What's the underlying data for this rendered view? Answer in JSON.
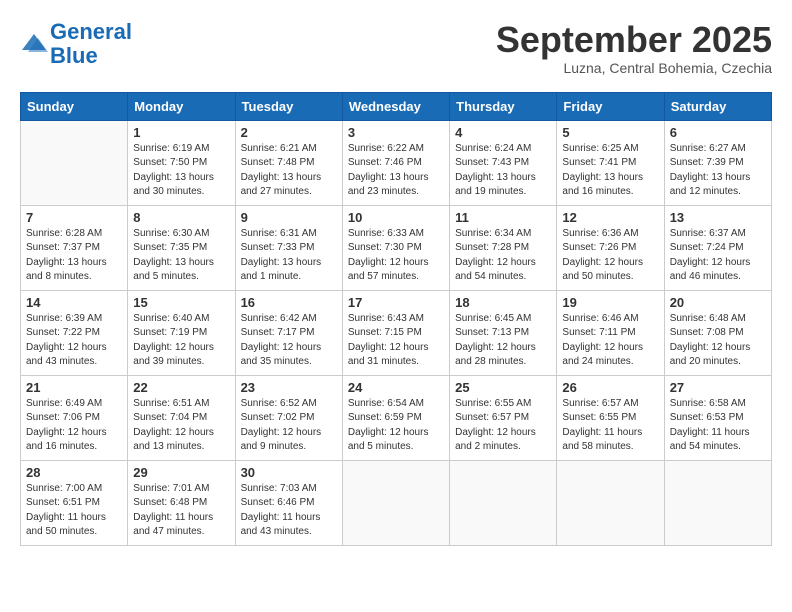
{
  "header": {
    "logo_line1": "General",
    "logo_line2": "Blue",
    "month": "September 2025",
    "location": "Luzna, Central Bohemia, Czechia"
  },
  "weekdays": [
    "Sunday",
    "Monday",
    "Tuesday",
    "Wednesday",
    "Thursday",
    "Friday",
    "Saturday"
  ],
  "weeks": [
    [
      {
        "day": "",
        "info": ""
      },
      {
        "day": "1",
        "info": "Sunrise: 6:19 AM\nSunset: 7:50 PM\nDaylight: 13 hours\nand 30 minutes."
      },
      {
        "day": "2",
        "info": "Sunrise: 6:21 AM\nSunset: 7:48 PM\nDaylight: 13 hours\nand 27 minutes."
      },
      {
        "day": "3",
        "info": "Sunrise: 6:22 AM\nSunset: 7:46 PM\nDaylight: 13 hours\nand 23 minutes."
      },
      {
        "day": "4",
        "info": "Sunrise: 6:24 AM\nSunset: 7:43 PM\nDaylight: 13 hours\nand 19 minutes."
      },
      {
        "day": "5",
        "info": "Sunrise: 6:25 AM\nSunset: 7:41 PM\nDaylight: 13 hours\nand 16 minutes."
      },
      {
        "day": "6",
        "info": "Sunrise: 6:27 AM\nSunset: 7:39 PM\nDaylight: 13 hours\nand 12 minutes."
      }
    ],
    [
      {
        "day": "7",
        "info": "Sunrise: 6:28 AM\nSunset: 7:37 PM\nDaylight: 13 hours\nand 8 minutes."
      },
      {
        "day": "8",
        "info": "Sunrise: 6:30 AM\nSunset: 7:35 PM\nDaylight: 13 hours\nand 5 minutes."
      },
      {
        "day": "9",
        "info": "Sunrise: 6:31 AM\nSunset: 7:33 PM\nDaylight: 13 hours\nand 1 minute."
      },
      {
        "day": "10",
        "info": "Sunrise: 6:33 AM\nSunset: 7:30 PM\nDaylight: 12 hours\nand 57 minutes."
      },
      {
        "day": "11",
        "info": "Sunrise: 6:34 AM\nSunset: 7:28 PM\nDaylight: 12 hours\nand 54 minutes."
      },
      {
        "day": "12",
        "info": "Sunrise: 6:36 AM\nSunset: 7:26 PM\nDaylight: 12 hours\nand 50 minutes."
      },
      {
        "day": "13",
        "info": "Sunrise: 6:37 AM\nSunset: 7:24 PM\nDaylight: 12 hours\nand 46 minutes."
      }
    ],
    [
      {
        "day": "14",
        "info": "Sunrise: 6:39 AM\nSunset: 7:22 PM\nDaylight: 12 hours\nand 43 minutes."
      },
      {
        "day": "15",
        "info": "Sunrise: 6:40 AM\nSunset: 7:19 PM\nDaylight: 12 hours\nand 39 minutes."
      },
      {
        "day": "16",
        "info": "Sunrise: 6:42 AM\nSunset: 7:17 PM\nDaylight: 12 hours\nand 35 minutes."
      },
      {
        "day": "17",
        "info": "Sunrise: 6:43 AM\nSunset: 7:15 PM\nDaylight: 12 hours\nand 31 minutes."
      },
      {
        "day": "18",
        "info": "Sunrise: 6:45 AM\nSunset: 7:13 PM\nDaylight: 12 hours\nand 28 minutes."
      },
      {
        "day": "19",
        "info": "Sunrise: 6:46 AM\nSunset: 7:11 PM\nDaylight: 12 hours\nand 24 minutes."
      },
      {
        "day": "20",
        "info": "Sunrise: 6:48 AM\nSunset: 7:08 PM\nDaylight: 12 hours\nand 20 minutes."
      }
    ],
    [
      {
        "day": "21",
        "info": "Sunrise: 6:49 AM\nSunset: 7:06 PM\nDaylight: 12 hours\nand 16 minutes."
      },
      {
        "day": "22",
        "info": "Sunrise: 6:51 AM\nSunset: 7:04 PM\nDaylight: 12 hours\nand 13 minutes."
      },
      {
        "day": "23",
        "info": "Sunrise: 6:52 AM\nSunset: 7:02 PM\nDaylight: 12 hours\nand 9 minutes."
      },
      {
        "day": "24",
        "info": "Sunrise: 6:54 AM\nSunset: 6:59 PM\nDaylight: 12 hours\nand 5 minutes."
      },
      {
        "day": "25",
        "info": "Sunrise: 6:55 AM\nSunset: 6:57 PM\nDaylight: 12 hours\nand 2 minutes."
      },
      {
        "day": "26",
        "info": "Sunrise: 6:57 AM\nSunset: 6:55 PM\nDaylight: 11 hours\nand 58 minutes."
      },
      {
        "day": "27",
        "info": "Sunrise: 6:58 AM\nSunset: 6:53 PM\nDaylight: 11 hours\nand 54 minutes."
      }
    ],
    [
      {
        "day": "28",
        "info": "Sunrise: 7:00 AM\nSunset: 6:51 PM\nDaylight: 11 hours\nand 50 minutes."
      },
      {
        "day": "29",
        "info": "Sunrise: 7:01 AM\nSunset: 6:48 PM\nDaylight: 11 hours\nand 47 minutes."
      },
      {
        "day": "30",
        "info": "Sunrise: 7:03 AM\nSunset: 6:46 PM\nDaylight: 11 hours\nand 43 minutes."
      },
      {
        "day": "",
        "info": ""
      },
      {
        "day": "",
        "info": ""
      },
      {
        "day": "",
        "info": ""
      },
      {
        "day": "",
        "info": ""
      }
    ]
  ]
}
